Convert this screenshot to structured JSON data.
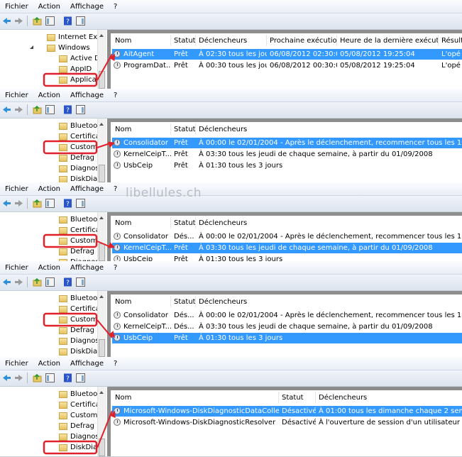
{
  "watermark": "libellules.ch",
  "colors": {
    "selection": "#3399ff",
    "highlight": "#e0202a"
  },
  "menu": [
    "Fichier",
    "Action",
    "Affichage",
    "?"
  ],
  "toolbar_icons": [
    "back-arrow-icon",
    "forward-arrow-icon",
    "folder-up-icon",
    "show-hide-tree-icon",
    "help-icon",
    "show-hide-action-pane-icon"
  ],
  "panels": [
    {
      "tree": [
        {
          "label": "Internet Explore",
          "level": 1
        },
        {
          "label": "Windows",
          "level": 1,
          "expanded": true
        },
        {
          "label": "Active Direc",
          "level": 2
        },
        {
          "label": "AppID",
          "level": 2
        },
        {
          "label": "Application",
          "level": 2,
          "highlighted": true
        }
      ],
      "columns": [
        "Nom",
        "Statut",
        "Déclencheurs",
        "Prochaine exécution",
        "Heure de la dernière exécution",
        "Résult"
      ],
      "rows": [
        {
          "cells": [
            "AitAgent",
            "Prêt",
            "À 02:30 tous les jours",
            "06/08/2012 02:30:00",
            "05/08/2012 19:25:04",
            "L'opé"
          ],
          "selected": true
        },
        {
          "cells": [
            "ProgramDat...",
            "Prêt",
            "À 00:30 tous les jours",
            "06/08/2012 00:30:00",
            "05/08/2012 19:25:04",
            "L'opé"
          ]
        }
      ]
    },
    {
      "tree": [
        {
          "label": "Bluetooth",
          "level": 2
        },
        {
          "label": "CertificateS",
          "level": 2
        },
        {
          "label": "Customer E",
          "level": 2,
          "highlighted": true
        },
        {
          "label": "Defrag",
          "level": 2
        },
        {
          "label": "Diagnosis",
          "level": 2
        },
        {
          "label": "DiskDiagno",
          "level": 2
        }
      ],
      "columns": [
        "Nom",
        "Statut",
        "Déclencheurs"
      ],
      "rows": [
        {
          "cells": [
            "Consolidator",
            "Prêt",
            "À 00:00 le 02/01/2004 - Après le déclenchement, recommencer tous les 19:00:00 indé"
          ],
          "selected": true
        },
        {
          "cells": [
            "KernelCeipT...",
            "Prêt",
            "À 03:30 tous les jeudi de chaque semaine, à partir du 01/09/2008"
          ]
        },
        {
          "cells": [
            "UsbCeip",
            "Prêt",
            "À 01:30 tous les 3 jours"
          ]
        }
      ]
    },
    {
      "tree": [
        {
          "label": "Bluetooth",
          "level": 2
        },
        {
          "label": "CertificateS",
          "level": 2
        },
        {
          "label": "Customer E",
          "level": 2,
          "highlighted": true
        },
        {
          "label": "Defrag",
          "level": 2
        },
        {
          "label": "Diagnosis",
          "level": 2
        }
      ],
      "columns": [
        "Nom",
        "Statut",
        "Déclencheurs"
      ],
      "rows": [
        {
          "cells": [
            "Consolidator",
            "Dés...",
            "À 00:00 le 02/01/2004 - Après le déclenchement, recommencer tous les 19:00:00 indé"
          ]
        },
        {
          "cells": [
            "KernelCeipT...",
            "Prêt",
            "À 03:30 tous les jeudi de chaque semaine, à partir du 01/09/2008"
          ],
          "selected": true
        },
        {
          "cells": [
            "UsbCeip",
            "Prêt",
            "À 01:30 tous les 3 jours"
          ]
        }
      ]
    },
    {
      "tree": [
        {
          "label": "Bluetooth",
          "level": 2
        },
        {
          "label": "CertificateS",
          "level": 2
        },
        {
          "label": "Customer E",
          "level": 2,
          "highlighted": true
        },
        {
          "label": "Defrag",
          "level": 2
        },
        {
          "label": "Diagnosis",
          "level": 2
        },
        {
          "label": "DiskDiagno",
          "level": 2
        }
      ],
      "columns": [
        "Nom",
        "Statut",
        "Déclencheurs"
      ],
      "rows": [
        {
          "cells": [
            "Consolidator",
            "Dés...",
            "À 00:00 le 02/01/2004 - Après le déclenchement, recommencer tous les 19:00:00 indé"
          ]
        },
        {
          "cells": [
            "KernelCeipT...",
            "Dés...",
            "À 03:30 tous les jeudi de chaque semaine, à partir du 01/09/2008"
          ]
        },
        {
          "cells": [
            "UsbCeip",
            "Prêt",
            "À 01:30 tous les 3 jours"
          ],
          "selected": true
        }
      ]
    },
    {
      "tree": [
        {
          "label": "Bluetooth",
          "level": 2
        },
        {
          "label": "CertificateS",
          "level": 2
        },
        {
          "label": "Customer E",
          "level": 2
        },
        {
          "label": "Defrag",
          "level": 2
        },
        {
          "label": "Diagnosis",
          "level": 2
        },
        {
          "label": "DiskDiagno",
          "level": 2,
          "highlighted": true
        }
      ],
      "columns": [
        "Nom",
        "Statut",
        "Déclencheurs"
      ],
      "rows": [
        {
          "cells": [
            "Microsoft-Windows-DiskDiagnosticDataCollector",
            "Désactivé",
            "À 01:00 tous les dimanche chaque 2 semaine,"
          ],
          "selected": true
        },
        {
          "cells": [
            "Microsoft-Windows-DiskDiagnosticResolver",
            "Désactivé",
            "À l'ouverture de session d'un utilisateur"
          ]
        }
      ]
    }
  ]
}
